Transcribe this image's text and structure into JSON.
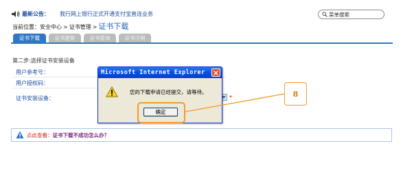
{
  "announcement": {
    "label": "最新公告：",
    "text": "我行网上银行正式开通支付宝直连业务"
  },
  "search": {
    "value": "菜单搜索"
  },
  "breadcrumb": {
    "prefix": "当前位置：",
    "items": [
      "安全中心",
      "证书管理"
    ],
    "separator": ">",
    "current": "证书下载"
  },
  "tabs": [
    {
      "label": "证书下载",
      "active": true
    },
    {
      "label": "证书更新",
      "active": false
    },
    {
      "label": "证书查询",
      "active": false
    },
    {
      "label": "证书注销",
      "active": false
    }
  ],
  "form": {
    "step_title": "第二步:选择证书安装设备",
    "fields": [
      {
        "label": "用户参考号："
      },
      {
        "label": "用户授权码："
      },
      {
        "label": "证书安装设备："
      }
    ],
    "required_mark": "*"
  },
  "dialog": {
    "title": "Microsoft Internet Explorer",
    "message": "您的下载申请已经提交，请等待。",
    "ok_label": "确定"
  },
  "callout": {
    "number": "8",
    "color": "#f39a2a"
  },
  "help": {
    "prefix": "点此查看：",
    "link": "证书下载不成功怎么办？"
  },
  "colors": {
    "accent": "#2f77c5",
    "link": "#1e4fa1",
    "dialog_title": "#0a4ee0"
  }
}
